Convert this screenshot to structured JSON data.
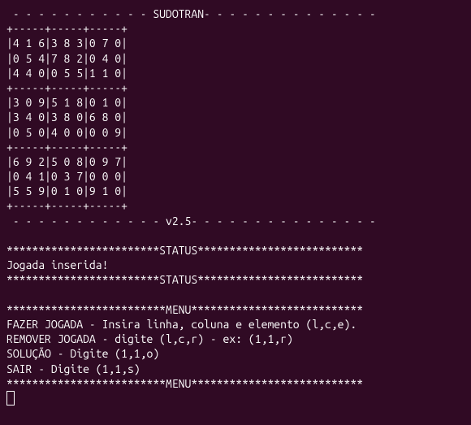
{
  "title_line": " - - - - - - - - - - - SUDOTRAN- - - - - - - - - - - - - - ",
  "border": "+-----+-----+-----+",
  "board": {
    "rows": [
      "|4 1 6|3 8 3|0 7 0|",
      "|0 5 4|7 8 2|0 4 0|",
      "|4 4 0|0 5 5|1 1 0|",
      "+-----+-----+-----+",
      "|3 0 9|5 1 8|0 1 0|",
      "|3 4 0|3 8 0|6 8 0|",
      "|0 5 0|4 0 0|0 0 9|",
      "+-----+-----+-----+",
      "|6 9 2|5 0 8|0 9 7|",
      "|0 4 1|0 3 7|0 0 0|",
      "|5 5 9|0 1 0|9 1 0|"
    ]
  },
  "version_line": " - - - - - - - - - - - - v2.5- - - - - - - - - - - - - - - ",
  "status": {
    "divider": "************************STATUS**************************",
    "message": "Jogada inserida!"
  },
  "menu": {
    "divider": "*************************MENU***************************",
    "option1": "FAZER JOGADA - Insira linha, coluna e elemento (l,c,e).",
    "option2": "REMOVER JOGADA - digite (l,c,r) - ex: (1,1,r)",
    "option3": "SOLUÇÃO - Digite (1,1,o)",
    "option4": "SAIR - Digite (1,1,s)"
  }
}
